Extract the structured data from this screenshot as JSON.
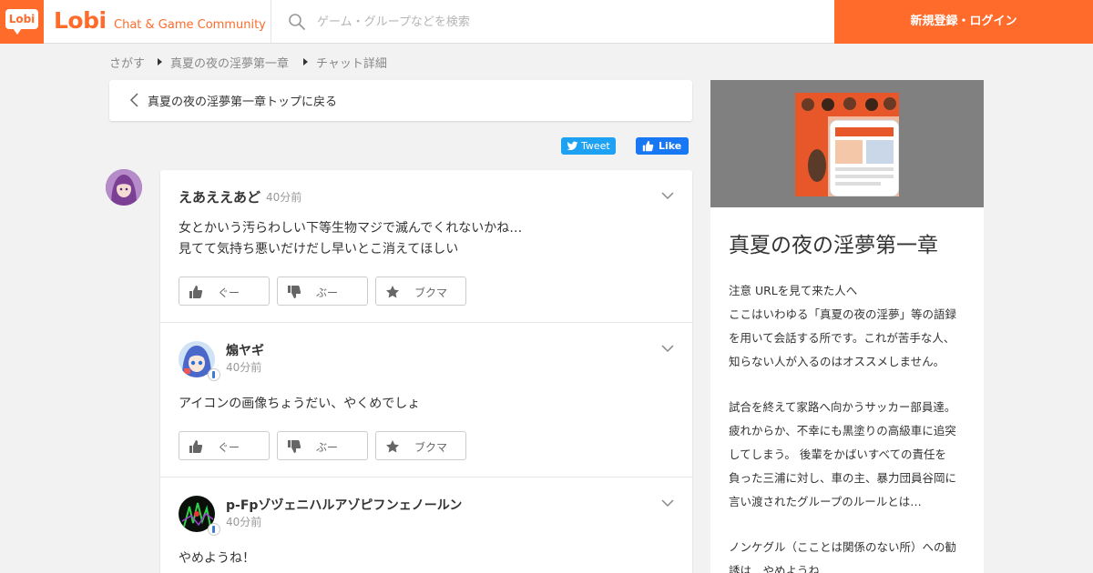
{
  "header": {
    "logo_mark": "Lobi",
    "brand": "Lobi",
    "tagline": "Chat & Game Community",
    "search_placeholder": "ゲーム・グループなどを検索",
    "signup_label": "新規登録・ログイン",
    "accent_color": "#ff6b2b"
  },
  "breadcrumb": {
    "items": [
      "さがす",
      "真夏の夜の淫夢第一章",
      "チャット詳細"
    ]
  },
  "back": {
    "label": "真夏の夜の淫夢第一章トップに戻る"
  },
  "share": {
    "tweet_label": "Tweet",
    "like_label": "Like"
  },
  "posts": [
    {
      "author": "えあええあど",
      "time": "40分前",
      "lines": [
        "女とかいう汚らわしい下等生物マジで滅んでくれないかね…",
        "見てて気持ち悪いだけだし早いとこ消えてほしい"
      ],
      "reactions": [
        "ぐー",
        "ぶー",
        "ブクマ"
      ]
    },
    {
      "author": "煽ヤギ",
      "time": "40分前",
      "lines": [
        "アイコンの画像ちょうだい、やくめでしょ"
      ],
      "reactions": [
        "ぐー",
        "ぶー",
        "ブクマ"
      ]
    },
    {
      "author": "p-Fpゾヅェニハルアゾピフンェノールン",
      "time": "40分前",
      "lines": [
        "やめようね！"
      ]
    }
  ],
  "sidebar": {
    "title": "真夏の夜の淫夢第一章",
    "description": [
      "注意 URLを見て来た人へ",
      "ここはいわゆる「真夏の夜の淫夢」等の語録",
      "を用いて会話する所です。これが苦手な人、",
      "知らない人が入るのはオススメしません。",
      "試合を終えて家路へ向かうサッカー部員達。",
      "疲れからか、不幸にも黒塗りの高級車に追突",
      "してしまう。 後輩をかばいすべての責任を",
      "負った三浦に対し、車の主、暴力団員谷岡に",
      "言い渡されたグループのルールとは…",
      "ノンケグル（こことは関係のない所）への勧",
      "誘は…やめようね"
    ]
  }
}
